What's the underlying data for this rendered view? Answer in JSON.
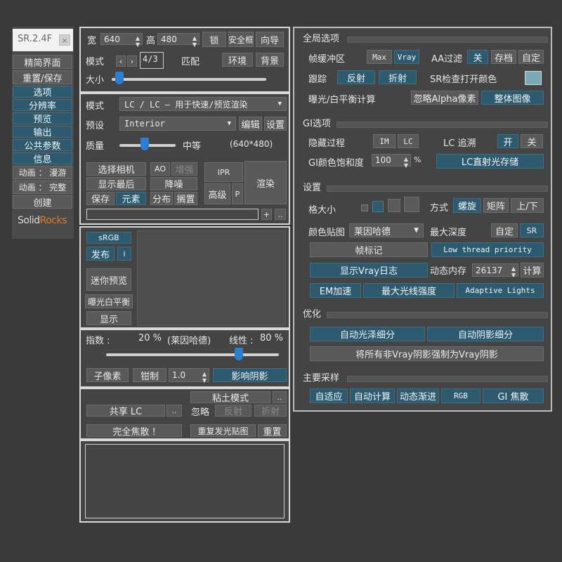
{
  "sidebar": {
    "version": "SR.2.4F",
    "close": "×",
    "items": [
      "精简界面",
      "重置/保存",
      "选项",
      "分辨率",
      "预览",
      "输出",
      "公共参数",
      "信息",
      "动画 ： 漫游",
      "动画 ： 完整",
      "创建"
    ],
    "logo_a": "Solid",
    "logo_b": "Rocks"
  },
  "res": {
    "width_label": "宽",
    "width": "640",
    "height_label": "高",
    "height": "480",
    "lock": "锁",
    "safe_frame": "安全框",
    "wizard": "向导",
    "mode_label": "模式",
    "ratio": "4/3",
    "match": "匹配",
    "env": "环境",
    "bg": "背景",
    "size_label": "大小"
  },
  "render": {
    "mode_label": "模式",
    "mode_value": "LC / LC – 用于快速/预览渲染",
    "preset_label": "预设",
    "preset_value": "Interior",
    "edit": "编辑",
    "settings": "设置",
    "quality_label": "质量",
    "quality_value": "中等",
    "res_text": "(640*480)",
    "select_camera": "选择相机",
    "ao": "AO",
    "enhance": "增强",
    "ipr": "IPR",
    "show_last": "显示最后",
    "denoise": "降噪",
    "advanced": "高级",
    "p": "P",
    "render": "渲染",
    "save": "保存",
    "elements": "元素",
    "distribute": "分布",
    "shelve": "搁置",
    "plus": "+",
    "dots": ".."
  },
  "preview": {
    "srgb": "sRGB",
    "publish": "发布",
    "info": "i",
    "mini": "迷你预览",
    "exposure": "曝光白平衡",
    "show": "显示"
  },
  "exposure": {
    "index_label": "指数 :",
    "index_value": "20 %",
    "reinhard": "(莱因哈德)",
    "linear_label": "线性 :",
    "linear_value": "80 %",
    "subpixel": "子像素",
    "clamp": "钳制",
    "clamp_value": "1.0",
    "affect_shadows": "影响阴影"
  },
  "misc": {
    "clay": "粘土模式",
    "dots": "..",
    "share_lc": "共享 LC",
    "ignore": "忽略",
    "reflect": "反射",
    "refract": "折射",
    "full_caustics": "完全焦散 !",
    "repeat_glow": "重复发光贴图",
    "reset": "重置"
  },
  "global": {
    "title": "全局选项",
    "fb_label": "帧缓冲区",
    "fb_max": "Max",
    "fb_vray": "Vray",
    "aa_label": "AA过滤",
    "aa_off": "关",
    "aa_save": "存档",
    "aa_custom": "自定",
    "trace_label": "跟踪",
    "reflect": "反射",
    "refract": "折射",
    "sr_check": "SR检查打开颜色",
    "exposure_calc": "曝光/白平衡计算",
    "ignore_alpha": "忽略Alpha像素",
    "whole_image": "整体图像"
  },
  "gi": {
    "title": "GI选项",
    "hide_label": "隐藏过程",
    "im": "IM",
    "lc": "LC",
    "lc_trace": "LC 追溯",
    "on": "开",
    "off": "关",
    "saturation_label": "GI颜色饱和度",
    "saturation_value": "100",
    "percent": "%",
    "lc_direct": "LC直射光存储"
  },
  "settings": {
    "title": "设置",
    "grid_label": "格大小",
    "method_label": "方式",
    "spiral": "螺旋",
    "matrix": "矩阵",
    "updown": "上/下",
    "colormap_label": "颜色贴图",
    "colormap_value": "莱因哈德",
    "max_depth": "最大深度",
    "custom": "自定",
    "sr": "SR",
    "frame_stamp": "帧标记",
    "low_thread": "Low thread priority",
    "show_log": "显示Vray日志",
    "dyn_mem": "动态内存",
    "dyn_mem_value": "26137",
    "calc": "计算",
    "em": "EM加速",
    "max_ray": "最大光线强度",
    "adaptive": "Adaptive Lights"
  },
  "optimize": {
    "title": "优化",
    "auto_gloss": "自动光泽细分",
    "auto_shadow": "自动阴影细分",
    "force_shadows": "将所有非Vray阴影强制为Vray阴影"
  },
  "sampler": {
    "title": "主要采样",
    "adaptive": "自适应",
    "auto_calc": "自动计算",
    "progressive": "动态渐进",
    "rgb": "RGB",
    "gi_caustics": "GI 焦散"
  },
  "colors": {
    "background": "#3a3a3a",
    "panel": "#444444",
    "button": "#595959",
    "active": "#2d5a6e",
    "slider_thumb": "#2a7fd0",
    "check_color": "#7aa8b5"
  },
  "icons": [
    "close-icon",
    "chevron-left-icon",
    "chevron-right-icon",
    "dropdown-arrow-icon",
    "spinner-arrows-icon"
  ]
}
